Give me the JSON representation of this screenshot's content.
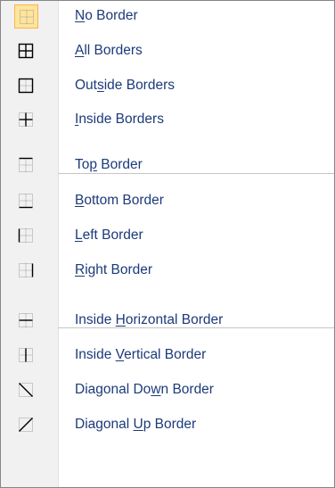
{
  "menu": {
    "items": [
      {
        "pre": "",
        "key": "N",
        "post": "o Border",
        "icon": "no-border-icon",
        "selected": true
      },
      {
        "pre": "",
        "key": "A",
        "post": "ll Borders",
        "icon": "all-borders-icon"
      },
      {
        "pre": "Out",
        "key": "s",
        "post": "ide Borders",
        "icon": "outside-borders-icon"
      },
      {
        "pre": "",
        "key": "I",
        "post": "nside Borders",
        "icon": "inside-borders-icon"
      },
      {
        "pre": "To",
        "key": "p",
        "post": " Border",
        "icon": "top-border-icon"
      },
      {
        "pre": "",
        "key": "B",
        "post": "ottom Border",
        "icon": "bottom-border-icon"
      },
      {
        "pre": "",
        "key": "L",
        "post": "eft Border",
        "icon": "left-border-icon"
      },
      {
        "pre": "",
        "key": "R",
        "post": "ight Border",
        "icon": "right-border-icon"
      },
      {
        "pre": "Inside ",
        "key": "H",
        "post": "orizontal Border",
        "icon": "inside-horizontal-border-icon"
      },
      {
        "pre": "Inside ",
        "key": "V",
        "post": "ertical Border",
        "icon": "inside-vertical-border-icon"
      },
      {
        "pre": "Diagonal Do",
        "key": "w",
        "post": "n Border",
        "icon": "diagonal-down-border-icon"
      },
      {
        "pre": "Diagonal ",
        "key": "U",
        "post": "p Border",
        "icon": "diagonal-up-border-icon"
      }
    ]
  },
  "colors": {
    "label": "#1c3a7a",
    "highlight_fill": "#ffe49a",
    "highlight_border": "#f5b54e",
    "icon_strip": "#f1f1f1"
  }
}
